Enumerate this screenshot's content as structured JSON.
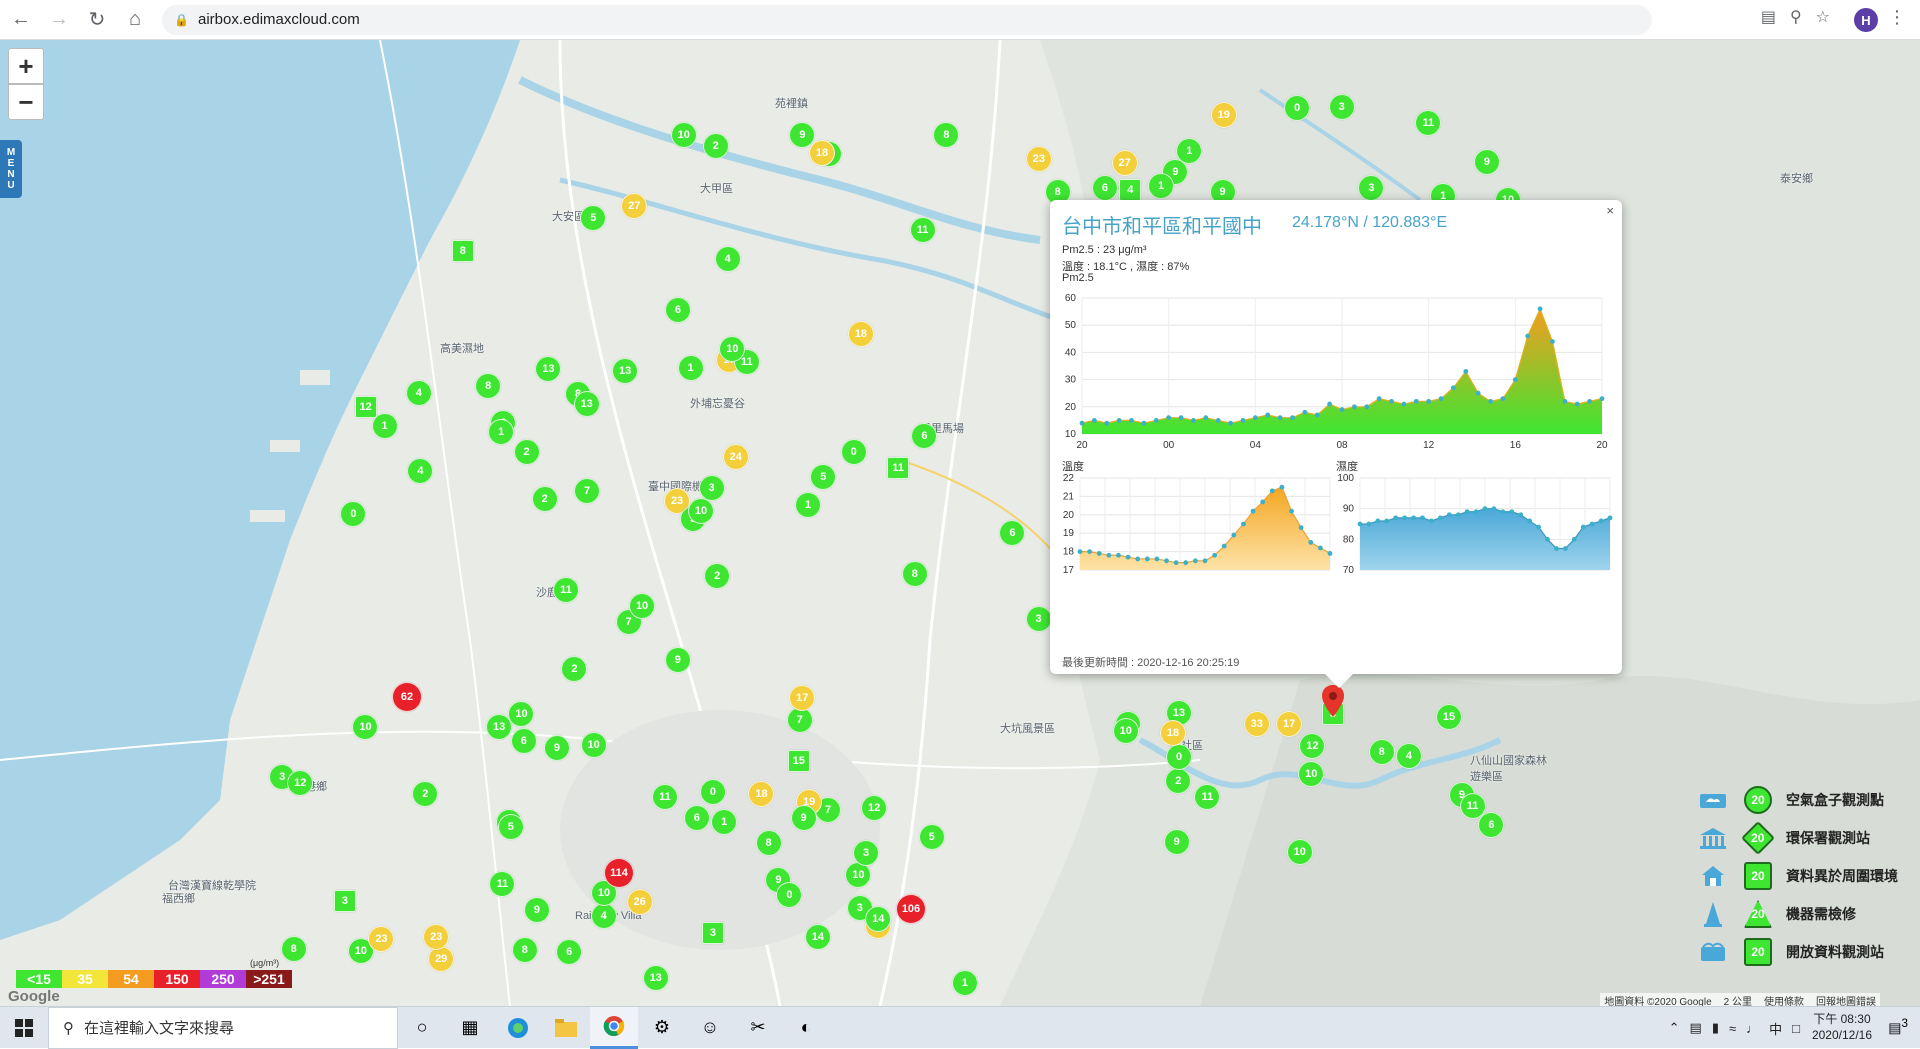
{
  "browser": {
    "url": "airbox.edimaxcloud.com",
    "profile_initial": "H"
  },
  "map": {
    "menu_label": [
      "M",
      "E",
      "N",
      "U"
    ],
    "place_labels": [
      {
        "text": "苑裡鎮"
      },
      {
        "text": "大安區"
      },
      {
        "text": "大甲區"
      },
      {
        "text": "高美濕地"
      },
      {
        "text": "沙鹿區"
      },
      {
        "text": "臺中國際機場"
      },
      {
        "text": "外埔忘憂谷"
      },
      {
        "text": "后里馬場"
      },
      {
        "text": "伸港鄉"
      },
      {
        "text": "台灣漢寶線乾學院"
      },
      {
        "text": "福西鄉"
      },
      {
        "text": "新社區"
      },
      {
        "text": "八仙山國家森林遊樂區"
      },
      {
        "text": "泰安鄉"
      },
      {
        "text": "大坑風景區"
      },
      {
        "text": "Rainbow Villa"
      }
    ],
    "markers": [
      {
        "v": "4",
        "c": "g"
      },
      {
        "v": "1",
        "c": "g"
      },
      {
        "v": "1",
        "c": "g"
      },
      {
        "v": "6",
        "c": "g"
      },
      {
        "v": "7",
        "c": "g"
      },
      {
        "v": "3",
        "c": "g"
      },
      {
        "v": "3",
        "c": "g"
      },
      {
        "v": "12",
        "c": "g"
      },
      {
        "v": "1",
        "c": "g"
      },
      {
        "v": "2",
        "c": "g"
      },
      {
        "v": "1",
        "c": "g"
      },
      {
        "v": "1",
        "c": "g"
      },
      {
        "v": "6",
        "c": "g"
      },
      {
        "v": "10",
        "c": "g"
      },
      {
        "v": "9",
        "c": "g"
      },
      {
        "v": "8",
        "c": "g"
      },
      {
        "v": "13",
        "c": "g"
      },
      {
        "v": "2",
        "c": "g"
      },
      {
        "v": "0",
        "c": "g"
      },
      {
        "v": "4",
        "c": "g"
      },
      {
        "v": "18",
        "c": "y"
      },
      {
        "v": "8",
        "c": "g"
      },
      {
        "v": "4",
        "c": "g"
      },
      {
        "v": "11",
        "c": "g"
      },
      {
        "v": "6",
        "c": "g"
      },
      {
        "v": "8",
        "c": "g"
      },
      {
        "v": "3",
        "c": "g"
      },
      {
        "v": "2",
        "c": "g"
      },
      {
        "v": "9",
        "c": "g"
      },
      {
        "v": "29",
        "c": "y"
      },
      {
        "v": "9",
        "c": "g"
      },
      {
        "v": "10",
        "c": "g"
      },
      {
        "v": "11",
        "c": "g"
      },
      {
        "v": "1",
        "c": "g"
      },
      {
        "v": "2",
        "c": "g"
      },
      {
        "v": "10",
        "c": "g"
      },
      {
        "v": "23",
        "c": "y"
      },
      {
        "v": "8",
        "c": "g"
      },
      {
        "v": "1",
        "c": "g"
      },
      {
        "v": "3",
        "c": "g"
      },
      {
        "v": "27",
        "c": "y"
      },
      {
        "v": "4",
        "c": "g"
      },
      {
        "v": "8",
        "c": "g"
      },
      {
        "v": "13",
        "c": "g"
      },
      {
        "v": "11",
        "c": "g"
      },
      {
        "v": "2",
        "c": "g"
      },
      {
        "v": "8",
        "c": "g"
      },
      {
        "v": "9",
        "c": "g"
      },
      {
        "v": "2",
        "c": "g"
      },
      {
        "v": "7",
        "c": "g"
      },
      {
        "v": "17",
        "c": "y"
      },
      {
        "v": "10",
        "c": "g"
      },
      {
        "v": "10",
        "c": "g"
      },
      {
        "v": "13",
        "c": "g"
      },
      {
        "v": "11",
        "c": "g"
      },
      {
        "v": "11",
        "c": "g"
      },
      {
        "v": "8",
        "c": "g"
      },
      {
        "v": "10",
        "c": "g"
      },
      {
        "v": "23",
        "c": "y"
      },
      {
        "v": "9",
        "c": "g"
      },
      {
        "v": "7",
        "c": "g"
      },
      {
        "v": "10",
        "c": "g"
      },
      {
        "v": "1",
        "c": "g"
      },
      {
        "v": "13",
        "c": "g"
      },
      {
        "v": "9",
        "c": "g"
      },
      {
        "v": "8",
        "c": "g"
      },
      {
        "v": "5",
        "c": "g"
      },
      {
        "v": "9",
        "c": "g"
      },
      {
        "v": "0",
        "c": "g"
      },
      {
        "v": "10",
        "c": "g"
      },
      {
        "v": "3",
        "c": "g"
      },
      {
        "v": "33",
        "c": "y"
      },
      {
        "v": "8",
        "c": "g"
      },
      {
        "v": "12",
        "c": "g"
      },
      {
        "v": "11",
        "c": "g"
      },
      {
        "v": "19",
        "c": "y"
      },
      {
        "v": "8",
        "c": "g"
      },
      {
        "v": "12",
        "c": "g"
      },
      {
        "v": "19",
        "c": "y"
      },
      {
        "v": "11",
        "c": "g"
      },
      {
        "v": "10",
        "c": "g"
      },
      {
        "v": "7",
        "c": "g"
      },
      {
        "v": "3",
        "c": "g"
      },
      {
        "v": "1",
        "c": "g"
      },
      {
        "v": "3",
        "c": "g"
      },
      {
        "v": "5",
        "c": "g"
      },
      {
        "v": "10",
        "c": "g"
      },
      {
        "v": "17",
        "c": "y"
      },
      {
        "v": "62",
        "c": "r"
      },
      {
        "v": "5",
        "c": "g"
      },
      {
        "v": "11",
        "c": "g"
      },
      {
        "v": "14",
        "c": "g"
      },
      {
        "v": "9",
        "c": "g"
      },
      {
        "v": "11",
        "c": "g"
      },
      {
        "v": "23",
        "c": "y"
      },
      {
        "v": "10",
        "c": "g"
      },
      {
        "v": "18",
        "c": "y"
      },
      {
        "v": "13",
        "c": "g"
      },
      {
        "v": "10",
        "c": "g"
      },
      {
        "v": "9",
        "c": "g"
      },
      {
        "v": "5",
        "c": "g"
      },
      {
        "v": "3",
        "c": "g"
      },
      {
        "v": "6",
        "c": "g"
      },
      {
        "v": "4",
        "c": "g"
      },
      {
        "v": "114",
        "c": "r"
      },
      {
        "v": "106",
        "c": "r"
      },
      {
        "v": "6",
        "c": "g"
      },
      {
        "v": "3",
        "c": "g"
      },
      {
        "v": "0",
        "c": "g"
      },
      {
        "v": "23",
        "c": "y"
      },
      {
        "v": "0",
        "c": "g"
      },
      {
        "v": "2",
        "c": "g"
      },
      {
        "v": "5",
        "c": "g"
      },
      {
        "v": "2",
        "c": "g"
      },
      {
        "v": "13",
        "c": "g"
      },
      {
        "v": "12",
        "c": "g"
      },
      {
        "v": "14",
        "c": "g"
      },
      {
        "v": "12",
        "c": "g"
      },
      {
        "v": "27",
        "c": "y"
      },
      {
        "v": "10",
        "c": "g"
      },
      {
        "v": "18",
        "c": "y"
      },
      {
        "v": "0",
        "c": "g"
      },
      {
        "v": "24",
        "c": "y"
      },
      {
        "v": "26",
        "c": "y"
      },
      {
        "v": "15",
        "c": "g"
      },
      {
        "v": "23",
        "c": "y"
      },
      {
        "v": "9",
        "c": "g"
      },
      {
        "v": "6",
        "c": "g"
      },
      {
        "v": "10",
        "c": "g"
      },
      {
        "v": "4",
        "c": "g"
      },
      {
        "v": "0",
        "c": "g"
      },
      {
        "v": "3",
        "c": "g"
      },
      {
        "v": "18",
        "c": "y"
      },
      {
        "v": "6",
        "c": "g"
      },
      {
        "v": "1",
        "c": "g"
      },
      {
        "v": "9",
        "c": "g"
      },
      {
        "v": "15",
        "c": "g"
      },
      {
        "v": "11",
        "c": "g"
      },
      {
        "v": "6",
        "c": "g"
      },
      {
        "v": "17",
        "c": "y"
      }
    ]
  },
  "popup": {
    "title": "台中市和平區和平國中",
    "coords": "24.178°N / 120.883°E",
    "pm25_line": "Pm2.5 : 23 μg/m³",
    "temp_humidity_line": "溫度 : 18.1°C , 濕度 : 87%",
    "chart_label": "Pm2.5",
    "temp_label": "溫度",
    "humidity_label": "濕度",
    "updated": "最後更新時間 : 2020-12-16 20:25:19",
    "close": "×"
  },
  "chart_data": [
    {
      "type": "area",
      "title": "",
      "xlabel": "",
      "ylabel": "",
      "x_ticks": [
        "20",
        "00",
        "04",
        "08",
        "12",
        "16",
        "20"
      ],
      "ylim": [
        10,
        60
      ],
      "y_ticks": [
        10,
        20,
        30,
        40,
        50,
        60
      ],
      "series": [
        {
          "values": [
            14,
            15,
            14,
            15,
            15,
            14,
            15,
            16,
            16,
            15,
            16,
            15,
            14,
            15,
            16,
            17,
            16,
            16,
            18,
            17,
            21,
            19,
            20,
            20,
            23,
            22,
            21,
            22,
            22,
            23,
            27,
            33,
            25,
            22,
            23,
            30,
            46,
            56,
            44,
            22,
            21,
            22,
            23
          ]
        }
      ]
    },
    {
      "type": "area",
      "title": "",
      "xlabel": "",
      "ylabel": "",
      "ylim": [
        17,
        22
      ],
      "y_ticks": [
        17,
        18,
        19,
        20,
        21,
        22
      ],
      "series": [
        {
          "values": [
            18.0,
            18.0,
            17.9,
            17.8,
            17.8,
            17.7,
            17.6,
            17.6,
            17.6,
            17.5,
            17.4,
            17.4,
            17.5,
            17.5,
            17.8,
            18.3,
            18.9,
            19.5,
            20.2,
            20.7,
            21.3,
            21.5,
            20.2,
            19.3,
            18.5,
            18.2,
            17.9
          ]
        }
      ]
    },
    {
      "type": "area",
      "title": "",
      "xlabel": "",
      "ylabel": "",
      "ylim": [
        70,
        100
      ],
      "y_ticks": [
        70,
        80,
        90,
        100
      ],
      "series": [
        {
          "values": [
            85,
            85,
            86,
            86,
            87,
            87,
            87,
            87,
            86,
            87,
            88,
            88,
            89,
            89,
            90,
            90,
            89,
            89,
            88,
            86,
            84,
            80,
            77,
            77,
            80,
            84,
            85,
            86,
            87
          ]
        }
      ]
    }
  ],
  "legend": {
    "items": [
      {
        "label": "空氣盒子觀測點",
        "badge": "20",
        "icon": "cloud-box-icon"
      },
      {
        "label": "環保署觀測站",
        "badge": "20",
        "icon": "government-building-icon"
      },
      {
        "label": "資料異於周圍環境",
        "badge": "20",
        "icon": "house-icon"
      },
      {
        "label": "機器需檢修",
        "badge": "20",
        "icon": "traffic-cone-icon"
      },
      {
        "label": "開放資料觀測站",
        "badge": "20",
        "icon": "open-data-icon"
      }
    ],
    "aqi_scale": [
      {
        "label": "<15",
        "color": "#3ee632"
      },
      {
        "label": "35",
        "color": "#f3e63b"
      },
      {
        "label": "54",
        "color": "#f39c20"
      },
      {
        "label": "150",
        "color": "#e8202a"
      },
      {
        "label": "250",
        "color": "#b23ad6"
      },
      {
        "label": ">251",
        "color": "#8a1a1a"
      }
    ],
    "unit": "(μg/m³)"
  },
  "attribution": {
    "google": "Google",
    "map_data": "地圖資料 ©2020 Google",
    "scale": "2 公里",
    "terms": "使用條款",
    "report": "回報地圖錯誤"
  },
  "taskbar": {
    "search_placeholder": "在這裡輸入文字來搜尋",
    "time": "下午 08:30",
    "date": "2020/12/16",
    "ime": "中",
    "notification_count": "3"
  }
}
